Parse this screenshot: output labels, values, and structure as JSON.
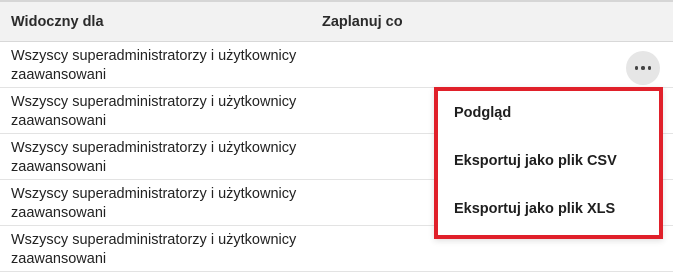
{
  "table": {
    "headers": {
      "visible_for": "Widoczny dla",
      "schedule": "Zaplanuj co"
    },
    "rows": [
      {
        "visible_for": "Wszyscy superadministratorzy i użytkownicy zaawansowani",
        "schedule": ""
      },
      {
        "visible_for": "Wszyscy superadministratorzy i użytkownicy zaawansowani",
        "schedule": ""
      },
      {
        "visible_for": "Wszyscy superadministratorzy i użytkownicy zaawansowani",
        "schedule": ""
      },
      {
        "visible_for": "Wszyscy superadministratorzy i użytkownicy zaawansowani",
        "schedule": ""
      },
      {
        "visible_for": "Wszyscy superadministratorzy i użytkownicy zaawansowani",
        "schedule": ""
      }
    ],
    "row_actions_icon": "more-horizontal-icon"
  },
  "context_menu": {
    "items": [
      {
        "label": "Podgląd"
      },
      {
        "label": "Eksportuj jako plik CSV"
      },
      {
        "label": "Eksportuj jako plik XLS"
      }
    ],
    "highlight_color": "#e0202a"
  }
}
